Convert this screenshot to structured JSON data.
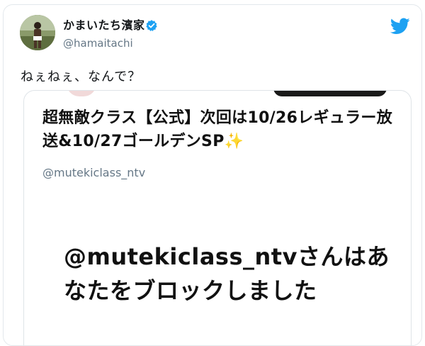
{
  "tweet": {
    "author": {
      "display_name": "かまいたち濱家",
      "handle": "@hamaitachi",
      "verified_icon": "verified-badge-icon",
      "avatar_icon": "avatar-photo"
    },
    "logo_icon": "twitter-bird-icon",
    "text": "ねぇねぇ、なんで？",
    "colors": {
      "twitter_blue": "#1da1f2",
      "name_text": "#14171a",
      "secondary_text": "#657786"
    }
  },
  "quoted": {
    "title_main": "超無敵クラス【公式】次回は10/26レギュラー放送&10/27ゴールデンSP",
    "title_emoji": "✨",
    "handle": "@mutekiclass_ntv",
    "block_message": "@mutekiclass_ntvさんはあなたをブロックしました"
  }
}
